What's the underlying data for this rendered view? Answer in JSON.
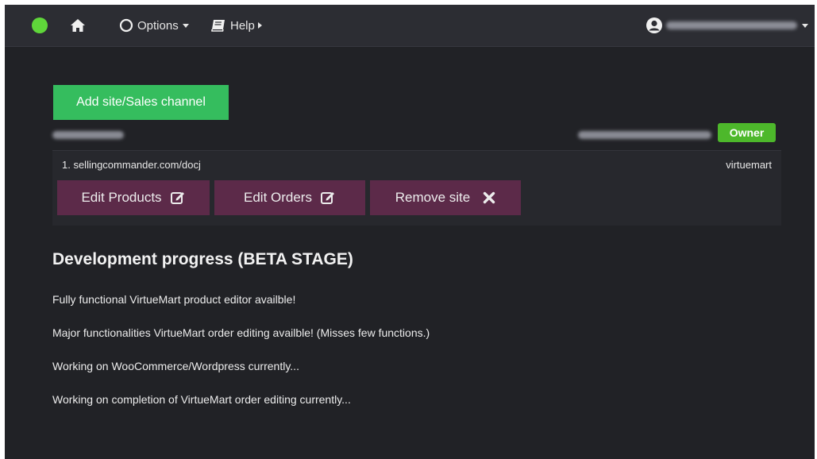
{
  "navbar": {
    "status_color": "#5fd63a",
    "home_icon": "home-icon",
    "options": {
      "icon": "circle-icon",
      "label": "Options"
    },
    "help": {
      "icon": "book-icon",
      "label": "Help"
    },
    "user": {
      "icon": "user-circle-icon"
    }
  },
  "add_site_button": {
    "label": "Add site/Sales channel"
  },
  "site": {
    "owner_badge": "Owner",
    "url": "1. sellingcommander.com/docj",
    "platform": "virtuemart",
    "actions": {
      "edit_products": "Edit Products",
      "edit_orders": "Edit Orders",
      "remove_site": "Remove site"
    }
  },
  "progress": {
    "title": "Development progress (BETA STAGE)",
    "lines": [
      "Fully functional VirtueMart product editor availble!",
      "Major functionalities VirtueMart order editing availble! (Misses few functions.)",
      "Working on WooCommerce/Wordpress currently...",
      "Working on completion of VirtueMart order editing currently..."
    ]
  },
  "colors": {
    "background": "#212226",
    "navbar": "#2c2d33",
    "add_button": "#35bd5e",
    "owner_badge": "#4db82b",
    "action_button": "#5c2a49"
  }
}
